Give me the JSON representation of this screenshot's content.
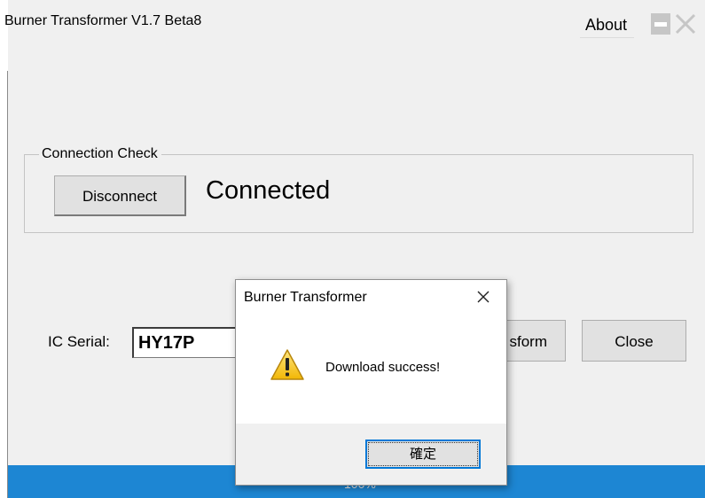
{
  "window": {
    "title": "Burner Transformer V1.7 Beta8",
    "about_label": "About",
    "minimize_icon": "minimize-icon",
    "close_icon": "close-icon"
  },
  "connection": {
    "group_label": "Connection Check",
    "disconnect_label": "Disconnect",
    "status_text": "Connected"
  },
  "ic": {
    "label": "IC Serial:",
    "value": "HY17P"
  },
  "buttons": {
    "transform_label": "sform",
    "close_label": "Close"
  },
  "progress": {
    "value_percent": 100,
    "text": "100%",
    "color": "#1d86d3"
  },
  "dialog": {
    "title": "Burner Transformer",
    "message": "Download success!",
    "ok_label": "確定",
    "icon": "warning-icon"
  }
}
